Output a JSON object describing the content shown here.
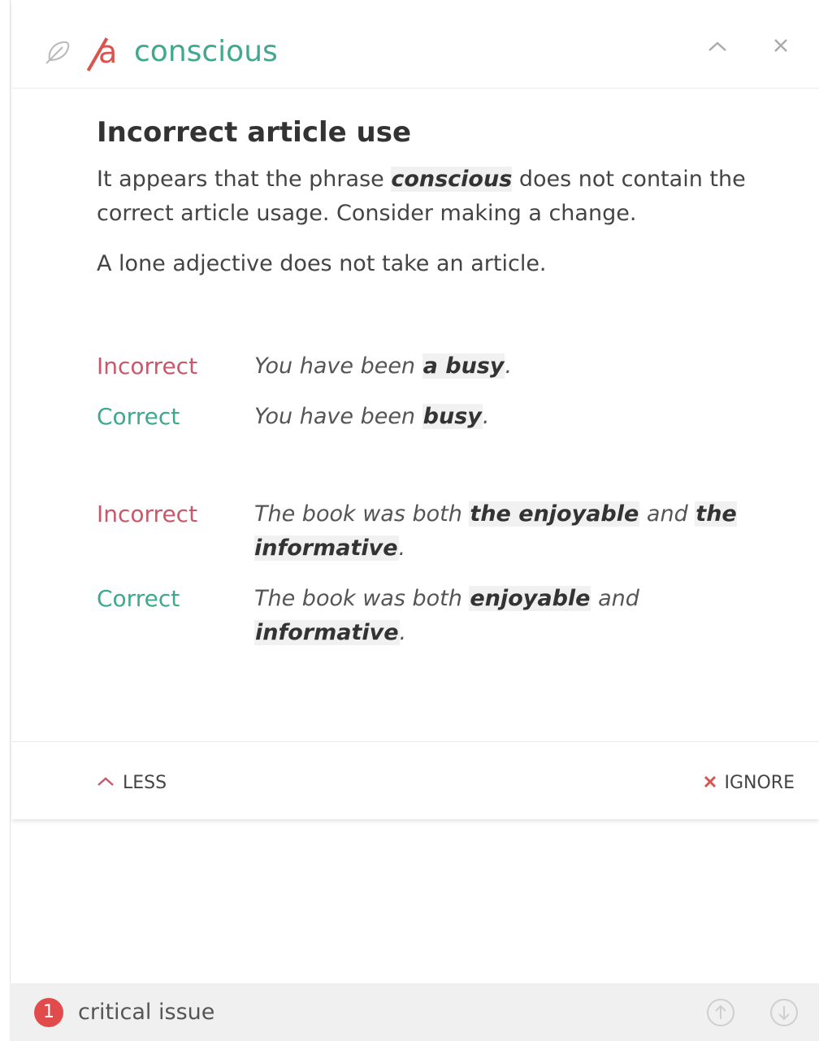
{
  "header": {
    "removed_article": "a",
    "suggestion_word": "conscious"
  },
  "explanation": {
    "title": "Incorrect article use",
    "para1_before": "It appears that the phrase ",
    "para1_phrase": "conscious",
    "para1_after": " does not contain the correct article usage. Consider making a change.",
    "para2": "A lone adjective does not take an article."
  },
  "examples": [
    {
      "incorrect_label": "Incorrect",
      "incorrect_parts": [
        "You have been ",
        "a busy",
        "."
      ],
      "correct_label": "Correct",
      "correct_parts": [
        "You have been ",
        "busy",
        "."
      ]
    },
    {
      "incorrect_label": "Incorrect",
      "incorrect_parts": [
        "The book was both ",
        "the enjoyable",
        " and ",
        "the informative",
        "."
      ],
      "correct_label": "Correct",
      "correct_parts": [
        "The book was both ",
        "enjoyable",
        " and ",
        "informative",
        "."
      ]
    }
  ],
  "footer": {
    "less_label": "LESS",
    "ignore_label": "IGNORE"
  },
  "status": {
    "issue_count": "1",
    "issue_text": "critical issue"
  },
  "colors": {
    "incorrect": "#c9596a",
    "correct": "#3fa88f",
    "badge": "#e24b4b"
  },
  "icons": [
    "feather-icon",
    "chevron-up-icon",
    "close-icon",
    "arrow-up-circle-icon",
    "arrow-down-circle-icon"
  ]
}
